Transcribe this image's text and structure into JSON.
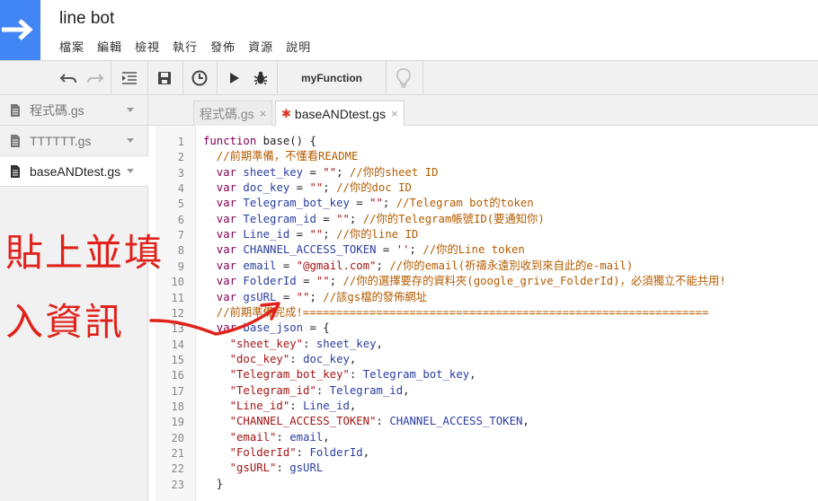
{
  "app": {
    "title": "line bot",
    "menu": [
      "檔案",
      "編輯",
      "檢視",
      "執行",
      "發佈",
      "資源",
      "說明"
    ]
  },
  "toolbar": {
    "function_select": "myFunction",
    "icons": [
      "undo-icon",
      "redo-icon",
      "indent-icon",
      "save-icon",
      "triggers-icon",
      "run-icon",
      "debug-icon",
      "lightbulb-icon"
    ]
  },
  "sidebar": {
    "files": [
      {
        "name": "程式碼.gs",
        "active": false
      },
      {
        "name": "TTTTTT.gs",
        "active": false
      },
      {
        "name": "baseANDtest.gs",
        "active": true
      }
    ]
  },
  "tabs": [
    {
      "label": "程式碼.gs",
      "active": false,
      "close": "×"
    },
    {
      "label": "baseANDtest.gs",
      "active": true,
      "dirty": "✱",
      "close": "×"
    }
  ],
  "editor": {
    "line_numbers": [
      "1",
      "2",
      "3",
      "4",
      "5",
      "6",
      "7",
      "8",
      "9",
      "10",
      "11",
      "12",
      "13",
      "14",
      "15",
      "16",
      "17",
      "18",
      "19",
      "20",
      "21",
      "22",
      "23"
    ],
    "lines": [
      [
        [
          "kw",
          "function"
        ],
        [
          "pl",
          " base() {"
        ]
      ],
      [
        [
          "cm",
          "  //前期準備，不懂看README"
        ]
      ],
      [
        [
          "kw",
          "  var"
        ],
        [
          "id",
          " sheet_key"
        ],
        [
          "pl",
          " = "
        ],
        [
          "str",
          "\"\""
        ],
        [
          "pl",
          "; "
        ],
        [
          "cm",
          "//你的sheet ID"
        ]
      ],
      [
        [
          "kw",
          "  var"
        ],
        [
          "id",
          " doc_key"
        ],
        [
          "pl",
          " = "
        ],
        [
          "str",
          "\"\""
        ],
        [
          "pl",
          "; "
        ],
        [
          "cm",
          "//你的doc ID"
        ]
      ],
      [
        [
          "kw",
          "  var"
        ],
        [
          "id",
          " Telegram_bot_key"
        ],
        [
          "pl",
          " = "
        ],
        [
          "str",
          "\"\""
        ],
        [
          "pl",
          "; "
        ],
        [
          "cm",
          "//Telegram bot的token"
        ]
      ],
      [
        [
          "kw",
          "  var"
        ],
        [
          "id",
          " Telegram_id"
        ],
        [
          "pl",
          " = "
        ],
        [
          "str",
          "\"\""
        ],
        [
          "pl",
          "; "
        ],
        [
          "cm",
          "//你的Telegram帳號ID(要通知你)"
        ]
      ],
      [
        [
          "kw",
          "  var"
        ],
        [
          "id",
          " Line_id"
        ],
        [
          "pl",
          " = "
        ],
        [
          "str",
          "\"\""
        ],
        [
          "pl",
          "; "
        ],
        [
          "cm",
          "//你的line ID"
        ]
      ],
      [
        [
          "kw",
          "  var"
        ],
        [
          "id",
          " CHANNEL_ACCESS_TOKEN"
        ],
        [
          "pl",
          " = "
        ],
        [
          "str",
          "''"
        ],
        [
          "pl",
          "; "
        ],
        [
          "cm",
          "//你的Line token"
        ]
      ],
      [
        [
          "kw",
          "  var"
        ],
        [
          "id",
          " email"
        ],
        [
          "pl",
          " = "
        ],
        [
          "str",
          "\"@gmail.com\""
        ],
        [
          "pl",
          "; "
        ],
        [
          "cm",
          "//你的email(祈禱永遠別收到來自此的e-mail)"
        ]
      ],
      [
        [
          "kw",
          "  var"
        ],
        [
          "id",
          " FolderId"
        ],
        [
          "pl",
          " = "
        ],
        [
          "str",
          "\"\""
        ],
        [
          "pl",
          "; "
        ],
        [
          "cm",
          "//你的選擇要存的資料夾(google_grive_FolderId)，必須獨立不能共用!"
        ]
      ],
      [
        [
          "kw",
          "  var"
        ],
        [
          "id",
          " gsURL"
        ],
        [
          "pl",
          " = "
        ],
        [
          "str",
          "\"\""
        ],
        [
          "pl",
          "; "
        ],
        [
          "cm",
          "//該gs檔的發佈網址"
        ]
      ],
      [
        [
          "cm",
          "  //前期準備完成!============================================================="
        ]
      ],
      [
        [
          "kw",
          "  var"
        ],
        [
          "id",
          " base_json"
        ],
        [
          "pl",
          " = {"
        ]
      ],
      [
        [
          "str",
          "    \"sheet_key\""
        ],
        [
          "pl",
          ": "
        ],
        [
          "id",
          "sheet_key"
        ],
        [
          "pl",
          ","
        ]
      ],
      [
        [
          "str",
          "    \"doc_key\""
        ],
        [
          "pl",
          ": "
        ],
        [
          "id",
          "doc_key"
        ],
        [
          "pl",
          ","
        ]
      ],
      [
        [
          "str",
          "    \"Telegram_bot_key\""
        ],
        [
          "pl",
          ": "
        ],
        [
          "id",
          "Telegram_bot_key"
        ],
        [
          "pl",
          ","
        ]
      ],
      [
        [
          "str",
          "    \"Telegram_id\""
        ],
        [
          "pl",
          ": "
        ],
        [
          "id",
          "Telegram_id"
        ],
        [
          "pl",
          ","
        ]
      ],
      [
        [
          "str",
          "    \"Line_id\""
        ],
        [
          "pl",
          ": "
        ],
        [
          "id",
          "Line_id"
        ],
        [
          "pl",
          ","
        ]
      ],
      [
        [
          "str",
          "    \"CHANNEL_ACCESS_TOKEN\""
        ],
        [
          "pl",
          ": "
        ],
        [
          "id",
          "CHANNEL_ACCESS_TOKEN"
        ],
        [
          "pl",
          ","
        ]
      ],
      [
        [
          "str",
          "    \"email\""
        ],
        [
          "pl",
          ": "
        ],
        [
          "id",
          "email"
        ],
        [
          "pl",
          ","
        ]
      ],
      [
        [
          "str",
          "    \"FolderId\""
        ],
        [
          "pl",
          ": "
        ],
        [
          "id",
          "FolderId"
        ],
        [
          "pl",
          ","
        ]
      ],
      [
        [
          "str",
          "    \"gsURL\""
        ],
        [
          "pl",
          ": "
        ],
        [
          "id",
          "gsURL"
        ]
      ],
      [
        [
          "pl",
          "  }"
        ]
      ]
    ]
  },
  "annotation": {
    "line1": "貼上並填",
    "line2": "入資訊",
    "color": "#e0221b"
  },
  "colors": {
    "logo": "#4285f4",
    "keyword": "#7f0055",
    "identifier": "#2a3ea0",
    "string": "#a31515",
    "comment": "#b35c00"
  }
}
